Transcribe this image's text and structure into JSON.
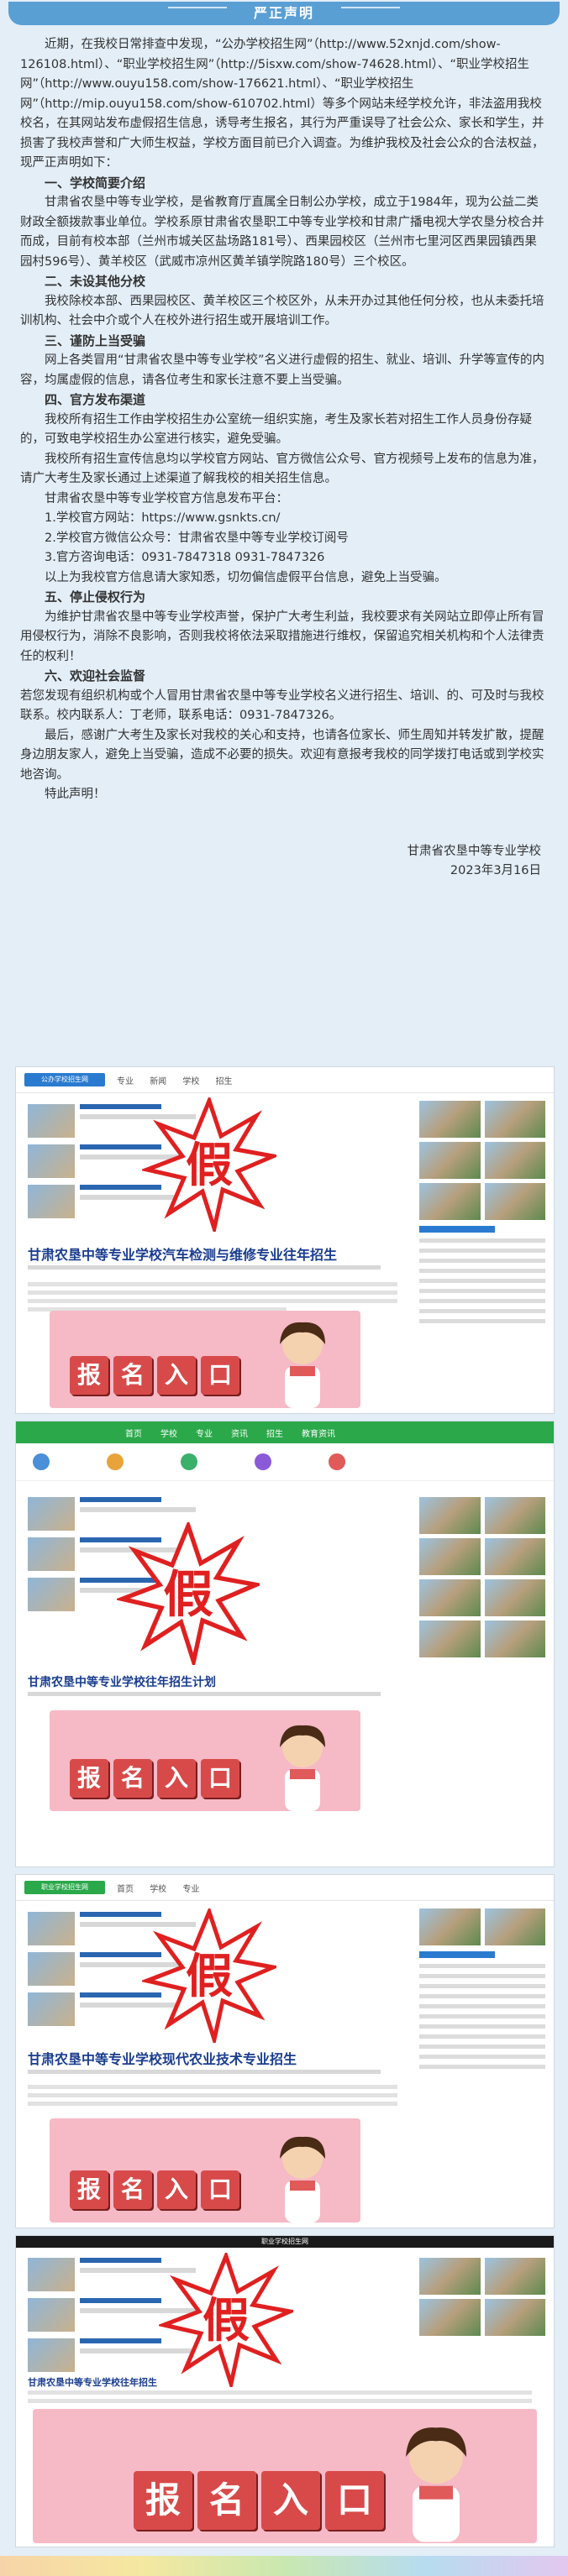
{
  "header": {
    "title": "严正声明"
  },
  "paragraphs": [
    {
      "id": "intro",
      "text": "近期，在我校日常排查中发现，“公办学校招生网”（http://www.52xnjd.com/show-126108.html）、“职业学校招生网”（http://5isxw.com/show-74628.html）、“职业学校招生网”（http://www.ouyu158.com/show-176621.html）、“职业学校招生网”（http://mip.ouyu158.com/show-610702.html）等多个网站未经学校允许，非法盗用我校校名，在其网站发布虚假招生信息，诱导考生报名，其行为严重误导了社会公众、家长和学生，并损害了我校声誉和广大师生权益，学校方面目前已介入调查。为维护我校及社会公众的合法权益，现严正声明如下："
    },
    {
      "id": "h1",
      "heading": true,
      "text": "一、学校简要介绍"
    },
    {
      "id": "p1",
      "text": "甘肃省农垦中等专业学校，是省教育厅直属全日制公办学校，成立于1984年，现为公益二类财政全额拨款事业单位。学校系原甘肃省农垦职工中等专业学校和甘肃广播电视大学农垦分校合并而成，目前有校本部（兰州市城关区盐场路181号）、西果园校区（兰州市七里河区西果园镇西果园村596号）、黄羊校区（武威市凉州区黄羊镇学院路180号）三个校区。"
    },
    {
      "id": "h2",
      "heading": true,
      "text": "二、未设其他分校"
    },
    {
      "id": "p2",
      "text": "我校除校本部、西果园校区、黄羊校区三个校区外，从未开办过其他任何分校，也从未委托培训机构、社会中介或个人在校外进行招生或开展培训工作。"
    },
    {
      "id": "h3",
      "heading": true,
      "text": "三、谨防上当受骗"
    },
    {
      "id": "p3",
      "text": "网上各类冒用“甘肃省农垦中等专业学校”名义进行虚假的招生、就业、培训、升学等宣传的内容，均属虚假的信息，请各位考生和家长注意不要上当受骗。"
    },
    {
      "id": "h4",
      "heading": true,
      "text": "四、官方发布渠道"
    },
    {
      "id": "p4a",
      "text": "我校所有招生工作由学校招生办公室统一组织实施，考生及家长若对招生工作人员身份存疑的，可致电学校招生办公室进行核实，避免受骗。"
    },
    {
      "id": "p4b",
      "text": "我校所有招生宣传信息均以学校官方网站、官方微信公众号、官方视频号上发布的信息为准，请广大考生及家长通过上述渠道了解我校的相关招生信息。"
    },
    {
      "id": "p4c",
      "text": "甘肃省农垦中等专业学校官方信息发布平台："
    },
    {
      "id": "p4d",
      "text": "1.学校官方网站：https://www.gsnkts.cn/"
    },
    {
      "id": "p4e",
      "text": "2.学校官方微信公众号：甘肃省农垦中等专业学校订阅号"
    },
    {
      "id": "p4f",
      "text": "3.官方咨询电话：0931-7847318  0931-7847326"
    },
    {
      "id": "p4g",
      "text": "以上为我校官方信息请大家知悉，切勿偏信虚假平台信息，避免上当受骗。"
    },
    {
      "id": "h5",
      "heading": true,
      "text": "五、停止侵权行为"
    },
    {
      "id": "p5",
      "text": "为维护甘肃省农垦中等专业学校声誉，保护广大考生利益，我校要求有关网站立即停止所有冒用侵权行为，消除不良影响，否则我校将依法采取措施进行维权，保留追究相关机构和个人法律责任的权利！"
    },
    {
      "id": "h6",
      "heading": true,
      "text": "六、欢迎社会监督"
    },
    {
      "id": "p6",
      "text": "若您发现有组织机构或个人冒用甘肃省农垦中等专业学校名义进行招生、培训、的、可及时与我校联系。校内联系人：丁老师，联系电话：0931-7847326。",
      "plain": true
    },
    {
      "id": "p7",
      "text": "最后，感谢广大考生及家长对我校的关心和支持，也请各位家长、师生周知并转发扩散，提醒身边朋友家人，避免上当受骗，造成不必要的损失。欢迎有意报考我校的同学拨打电话或到学校实地咨询。"
    },
    {
      "id": "p8",
      "text": "特此声明！"
    }
  ],
  "signature": {
    "org": "甘肃省农垦中等专业学校",
    "date": "2023年3月16日"
  },
  "screenshots": [
    {
      "nav": [
        "公办学校招生网",
        "专业",
        "新闻",
        "学校",
        "招生"
      ],
      "heading": "甘肃农垦中等专业学校汽车检测与维修专业往年招生",
      "fake": "假",
      "banner": [
        "报",
        "名",
        "入",
        "口"
      ]
    },
    {
      "nav": [
        "首页",
        "学校",
        "专业",
        "资讯",
        "招生",
        "教育资讯"
      ],
      "heading": "甘肃农垦中等专业学校往年招生计划",
      "fake": "假",
      "banner": [
        "报",
        "名",
        "入",
        "口"
      ]
    },
    {
      "nav": [
        "职业学校招生网",
        "首页",
        "学校",
        "专业"
      ],
      "heading": "甘肃农垦中等专业学校现代农业技术专业招生",
      "fake": "假",
      "banner": [
        "报",
        "名",
        "入",
        "口"
      ]
    },
    {
      "nav": [
        "职业学校招生网"
      ],
      "heading": "甘肃农垦中等专业学校往年招生",
      "fake": "假",
      "banner": [
        "报",
        "名",
        "入",
        "口"
      ]
    }
  ],
  "colors": {
    "titlebar": "#5a9fd4",
    "fake_red": "#e02020",
    "banner_pink": "#f6b9c6"
  }
}
